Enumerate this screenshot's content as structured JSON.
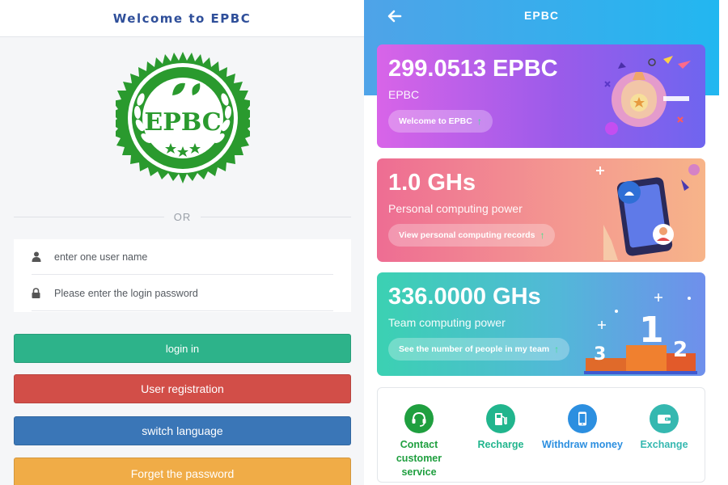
{
  "left": {
    "header_title": "Welcome to EPBC",
    "logo_text": "EPBC",
    "or_text": "OR",
    "username_placeholder": "enter one user name",
    "password_placeholder": "Please enter the login password",
    "buttons": {
      "login": "login in",
      "register": "User registration",
      "language": "switch language",
      "forget": "Forget the password"
    }
  },
  "right": {
    "header_title": "EPBC",
    "cards": [
      {
        "value": "299.0513 EPBC",
        "subtitle": "EPBC",
        "action": "Welcome to EPBC"
      },
      {
        "value": "1.0 GHs",
        "subtitle": "Personal computing power",
        "action": "View personal computing records"
      },
      {
        "value": "336.0000 GHs",
        "subtitle": "Team computing power",
        "action": "See the number of people in my team"
      }
    ],
    "quick_actions": [
      {
        "label": "Contact customer service",
        "icon": "headset-icon",
        "color": "#1f9f3f"
      },
      {
        "label": "Recharge",
        "icon": "gas-pump-icon",
        "color": "#21b58d"
      },
      {
        "label": "Withdraw money",
        "icon": "phone-icon",
        "color": "#2c8fe0"
      },
      {
        "label": "Exchange",
        "icon": "wallet-icon",
        "color": "#35b8b0"
      }
    ]
  },
  "colors": {
    "login": "#2db38a",
    "register": "#d24e48",
    "language": "#3a76b7",
    "forget": "#f0ac47",
    "logo_green": "#2a9a2e"
  }
}
